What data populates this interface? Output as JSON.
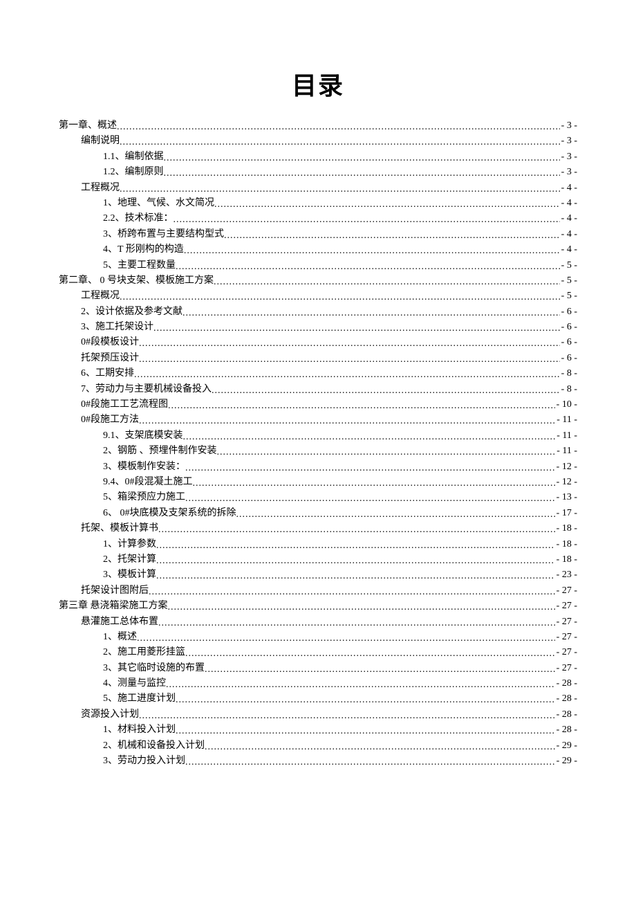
{
  "title": "目录",
  "toc": [
    {
      "level": 0,
      "label": "第一章、概述",
      "page": "- 3 -"
    },
    {
      "level": 1,
      "label": "编制说明",
      "page": "- 3 -"
    },
    {
      "level": 2,
      "label": "1.1、编制依据",
      "page": "- 3 -"
    },
    {
      "level": 2,
      "label": "1.2、编制原则",
      "page": "- 3 -"
    },
    {
      "level": 1,
      "label": "工程概况",
      "page": "- 4 -"
    },
    {
      "level": 2,
      "label": "1、地理、气候、水文简况",
      "page": "- 4 -"
    },
    {
      "level": 2,
      "label": "2.2、技术标准：",
      "page": "- 4 -"
    },
    {
      "level": 2,
      "label": "3、桥跨布置与主要结构型式",
      "page": "- 4 -"
    },
    {
      "level": 2,
      "label": "4、T 形刚构的构造",
      "page": "- 4 -"
    },
    {
      "level": 2,
      "label": "5、主要工程数量",
      "page": "- 5 -"
    },
    {
      "level": 0,
      "label": "第二章、 0 号块支架、模板施工方案",
      "page": "- 5 -"
    },
    {
      "level": 1,
      "label": "工程概况",
      "page": "- 5 -"
    },
    {
      "level": 1,
      "label": "2、设计依据及参考文献",
      "page": "- 6 -"
    },
    {
      "level": 1,
      "label": "3、施工托架设计",
      "page": "- 6 -"
    },
    {
      "level": 1,
      "label": "0#段模板设计",
      "page": "- 6 -"
    },
    {
      "level": 1,
      "label": "托架预压设计",
      "page": "- 6 -"
    },
    {
      "level": 1,
      "label": "6、工期安排",
      "page": "- 8 -"
    },
    {
      "level": 1,
      "label": "7、劳动力与主要机械设备投入",
      "page": "- 8 -"
    },
    {
      "level": 1,
      "label": "0#段施工工艺流程图",
      "page": "- 10 -"
    },
    {
      "level": 1,
      "label": "0#段施工方法",
      "page": "- 11 -"
    },
    {
      "level": 2,
      "label": "9.1、支架底模安装",
      "page": "- 11 -"
    },
    {
      "level": 2,
      "label": "2、钢筋 、预埋件制作安装",
      "page": "- 11 -"
    },
    {
      "level": 2,
      "label": "3、模板制作安装：",
      "page": "- 12 -"
    },
    {
      "level": 2,
      "label": "9.4、0#段混凝土施工",
      "page": "- 12 -"
    },
    {
      "level": 2,
      "label": "5、箱梁预应力施工",
      "page": "- 13 -"
    },
    {
      "level": 2,
      "label": "6、 0#块底模及支架系统的拆除",
      "page": "- 17 -"
    },
    {
      "level": 1,
      "label": "托架、模板计算书",
      "page": "- 18 -"
    },
    {
      "level": 2,
      "label": "1、计算参数",
      "page": "- 18 -"
    },
    {
      "level": 2,
      "label": "2、托架计算",
      "page": "- 18 -"
    },
    {
      "level": 2,
      "label": "3、模板计算",
      "page": "- 23 -"
    },
    {
      "level": 1,
      "label": "托架设计图附后",
      "page": "- 27 -"
    },
    {
      "level": 0,
      "label": "第三章 悬浇箱梁施工方案",
      "page": "- 27 -"
    },
    {
      "level": 1,
      "label": "悬灌施工总体布置",
      "page": "- 27 -"
    },
    {
      "level": 2,
      "label": "1、概述",
      "page": "- 27 -"
    },
    {
      "level": 2,
      "label": "2、施工用菱形挂篮",
      "page": "- 27 -"
    },
    {
      "level": 2,
      "label": "3、其它临时设施的布置",
      "page": "- 27 -"
    },
    {
      "level": 2,
      "label": "4、测量与监控",
      "page": "- 28 -"
    },
    {
      "level": 2,
      "label": "5、施工进度计划",
      "page": "- 28 -"
    },
    {
      "level": 1,
      "label": "资源投入计划",
      "page": "- 28 -"
    },
    {
      "level": 2,
      "label": "1、材料投入计划",
      "page": "- 28 -"
    },
    {
      "level": 2,
      "label": "2、机械和设备投入计划",
      "page": "- 29 -"
    },
    {
      "level": 2,
      "label": "3、劳动力投入计划",
      "page": "- 29 -"
    }
  ]
}
